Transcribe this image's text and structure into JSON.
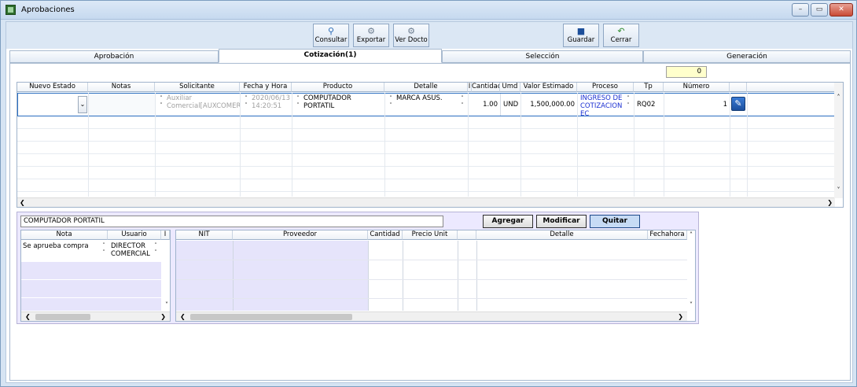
{
  "window": {
    "title": "Aprobaciones",
    "controls": [
      "–",
      "▭",
      "✕"
    ]
  },
  "toolbar": {
    "consultar": "Consultar",
    "exportar": "Exportar",
    "ver_docto": "Ver Docto",
    "guardar": "Guardar",
    "cerrar": "Cerrar"
  },
  "tabs": [
    {
      "label": "Aprobación"
    },
    {
      "label": "Cotización(1)"
    },
    {
      "label": "Selección"
    },
    {
      "label": "Generación"
    }
  ],
  "count_value": "0",
  "main_grid": {
    "headers": [
      "Nuevo Estado",
      "Notas",
      "Solicitante",
      "Fecha y Hora",
      "Producto",
      "Detalle",
      "I",
      "Cantidad",
      "Umd",
      "Valor Estimado",
      "Proceso",
      "Tp",
      "Número"
    ],
    "row": {
      "nuevo_estado": "",
      "notas": "",
      "solicitante": "Auxiliar Comercial[AUXCOMER]",
      "fecha_hora": "2020/06/13 14:20:51",
      "producto": "COMPUTADOR PORTATIL",
      "detalle": "MARCA ASUS.",
      "cantidad": "1.00",
      "umd": "UND",
      "valor_estimado": "1,500,000.00",
      "proceso": "INGRESO DE COTIZACION EC",
      "tp": "RQ02",
      "numero": "1"
    }
  },
  "detail": {
    "selected_product": "COMPUTADOR PORTATIL",
    "buttons": {
      "agregar": "Agregar",
      "modificar": "Modificar",
      "quitar": "Quitar"
    },
    "notes_grid": {
      "headers": [
        "Nota",
        "Usuario",
        "I"
      ],
      "rows": [
        {
          "nota": "Se aprueba compra",
          "usuario": "DIRECTOR COMERCIAL"
        }
      ]
    },
    "suppliers_grid": {
      "headers": [
        "NIT",
        "Proveedor",
        "Cantidad",
        "Precio Unit",
        "",
        "Detalle",
        "Fechahora"
      ]
    }
  },
  "colors": {
    "accent": "#2a6ec0",
    "lavender": "#ece9ff",
    "process_text": "#1a2fd1"
  },
  "icons": {
    "consultar": "magnifier-icon",
    "exportar": "export-icon",
    "ver_docto": "document-icon",
    "guardar": "save-icon",
    "cerrar": "close-arrow-icon",
    "attach": "paperclip-icon"
  }
}
